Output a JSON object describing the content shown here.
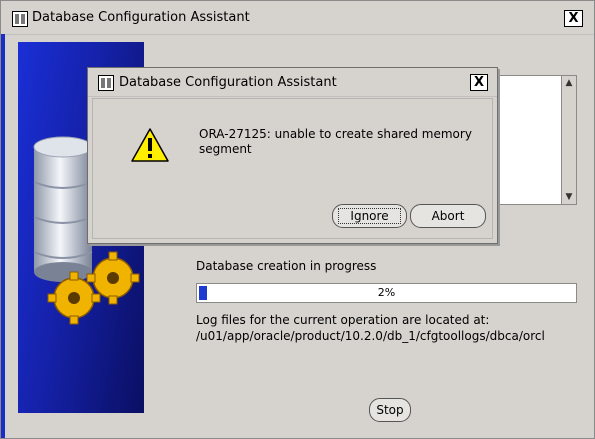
{
  "main_window": {
    "title": "Database Configuration Assistant",
    "close_label": "X",
    "status_label": "Database creation in progress",
    "progress": {
      "value_percent": 2,
      "label": "2%"
    },
    "log_info": {
      "line1": "Log files for the current operation are located at:",
      "line2": "/u01/app/oracle/product/10.2.0/db_1/cfgtoollogs/dbca/orcl"
    },
    "stop_label": "Stop"
  },
  "dialog": {
    "title": "Database Configuration Assistant",
    "close_label": "X",
    "message": "ORA-27125: unable to create shared memory segment",
    "ignore_label": "Ignore",
    "abort_label": "Abort",
    "icon": "warning-icon"
  },
  "colors": {
    "window_bg": "#d6d3ce",
    "banner_blue": "#1a2fd6",
    "progress_fill": "#1f3ad0",
    "warning_yellow": "#ffee00"
  }
}
